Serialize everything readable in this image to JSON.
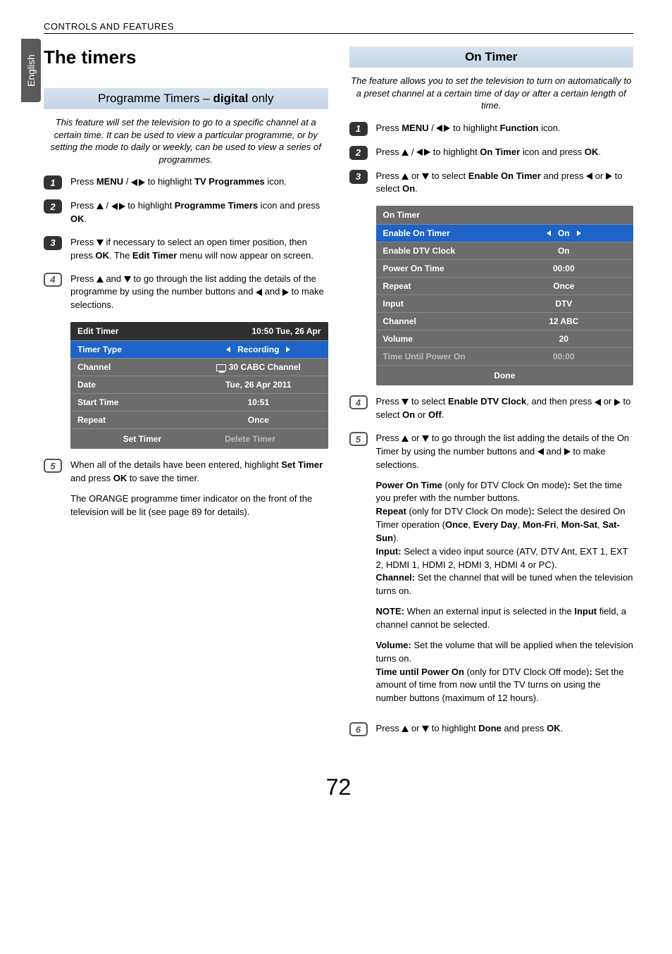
{
  "side_tab": "English",
  "header": "CONTROLS AND FEATURES",
  "page_number": "72",
  "left": {
    "title": "The timers",
    "section_bar": {
      "pre": "Programme Timers – ",
      "bold": "digital",
      "post": " only"
    },
    "intro": "This feature will set the television to go to a specific channel at a certain time. It can be used to view a particular programme, or by setting the mode to daily or weekly, can be used to view a series of programmes.",
    "steps": {
      "s1": {
        "pre": "Press ",
        "b1": "MENU",
        "mid": " / ",
        "post": " to highlight ",
        "b2": "TV Programmes",
        "end": " icon."
      },
      "s2": {
        "pre": "Press ",
        "mid1": " / ",
        "mid2": " to highlight ",
        "b1": "Programme Timers",
        "mid3": "  icon and press ",
        "b2": "OK",
        "end": "."
      },
      "s3": {
        "pre": "Press ",
        "mid": " if necessary to select an open timer position, then press ",
        "b1": "OK",
        "mid2": ". The ",
        "b2": "Edit Timer",
        "end": " menu will now appear on screen."
      },
      "s4": {
        "pre": "Press ",
        "mid1": " and ",
        "mid2": " to go through the list adding the details of the programme by using the number buttons and ",
        "mid3": " and ",
        "end": " to make selections."
      },
      "s5": {
        "pre": "When all of the details have been entered, highlight ",
        "b1": "Set Timer",
        "mid": " and press ",
        "b2": "OK",
        "end": " to save the timer."
      },
      "s5b": "The ORANGE programme timer indicator on the front of the television will be lit (see page 89 for details)."
    },
    "osd": {
      "title_left": "Edit Timer",
      "title_right": "10:50 Tue, 26 Apr",
      "rows": [
        {
          "label": "Timer Type",
          "value": "Recording",
          "highlight": true
        },
        {
          "label": "Channel",
          "value": "30 CABC Channel",
          "tvicon": true
        },
        {
          "label": "Date",
          "value": "Tue, 26 Apr 2011"
        },
        {
          "label": "Start Time",
          "value": "10:51"
        },
        {
          "label": "Repeat",
          "value": "Once"
        }
      ],
      "footer": {
        "btn1": "Set Timer",
        "btn2": "Delete Timer"
      }
    }
  },
  "right": {
    "section_bar": "On Timer",
    "intro": "The feature allows you to set the television to turn on automatically to a preset channel at a certain time of day or after a certain length of time.",
    "steps": {
      "s1": {
        "pre": "Press ",
        "b1": "MENU",
        "mid": " / ",
        "post": " to highlight ",
        "b2": "Function",
        "end": " icon."
      },
      "s2": {
        "pre": "Press ",
        "mid1": " / ",
        "mid2": " to highlight ",
        "b1": "On Timer",
        "mid3": " icon and press ",
        "b2": "OK",
        "end": "."
      },
      "s3": {
        "pre": "Press ",
        "mid1": " or ",
        "mid2": " to select ",
        "b1": "Enable On Timer",
        "mid3": " and press ",
        "mid4": " or ",
        "mid5": " to select ",
        "b2": "On",
        "end": "."
      },
      "s4": {
        "pre": "Press ",
        "mid1": " to select ",
        "b1": "Enable DTV Clock",
        "mid2": ", and then press ",
        "mid3": " or ",
        "mid4": " to select ",
        "b2": "On",
        "mid5": " or ",
        "b3": "Off",
        "end": "."
      },
      "s5": {
        "pre": "Press ",
        "mid1": " or ",
        "mid2": " to go through the list adding the details of the On Timer by using the number buttons and ",
        "mid3": " and ",
        "end": " to make selections."
      },
      "s6": {
        "pre": "Press ",
        "mid1": " or ",
        "mid2": " to highlight ",
        "b1": "Done",
        "mid3": " and press ",
        "b2": "OK",
        "end": "."
      }
    },
    "details": {
      "p1_b": "Power On Time",
      "p1_mid": " (only for DTV Clock On mode)",
      "p1_colon": ":",
      "p1_txt": " Set the time you prefer with the number buttons.",
      "p2_b": "Repeat",
      "p2_mid": " (only for DTV Clock On mode)",
      "p2_colon": ":",
      "p2_txt": " Select the desired On Timer operation (",
      "p2_o1": "Once",
      "p2_c": ", ",
      "p2_o2": "Every Day",
      "p2_o3": "Mon-Fri",
      "p2_o4": "Mon-Sat",
      "p2_o5": "Sat-Sun",
      "p2_end": ").",
      "p3_b": "Input:",
      "p3_txt": " Select a video input source (ATV, DTV Ant, EXT 1, EXT 2, HDMI 1, HDMI 2, HDMI 3, HDMI 4 or PC).",
      "p4_b": "Channel:",
      "p4_txt": " Set the channel that will be tuned when the television turns on.",
      "note_b": "NOTE:",
      "note_txt": " When an external input is selected in the ",
      "note_b2": "Input",
      "note_end": " field, a channel cannot be selected.",
      "p5_b": "Volume:",
      "p5_txt": " Set the volume that will be applied when the television turns on.",
      "p6_b": "Time until Power On",
      "p6_mid": " (only for DTV Clock Off mode)",
      "p6_colon": ":",
      "p6_txt": " Set the amount of time from now until the TV turns on using the number buttons (maximum of 12 hours)."
    },
    "osd": {
      "title": "On Timer",
      "rows": [
        {
          "label": "Enable On Timer",
          "value": "On",
          "highlight": true
        },
        {
          "label": "Enable DTV Clock",
          "value": "On"
        },
        {
          "label": "Power On Time",
          "value": "00:00"
        },
        {
          "label": "Repeat",
          "value": "Once"
        },
        {
          "label": "Input",
          "value": "DTV"
        },
        {
          "label": "Channel",
          "value": "12 ABC"
        },
        {
          "label": "Volume",
          "value": "20"
        },
        {
          "label": "Time Until Power On",
          "value": "00:00",
          "dim": true
        }
      ],
      "footer": "Done"
    }
  }
}
